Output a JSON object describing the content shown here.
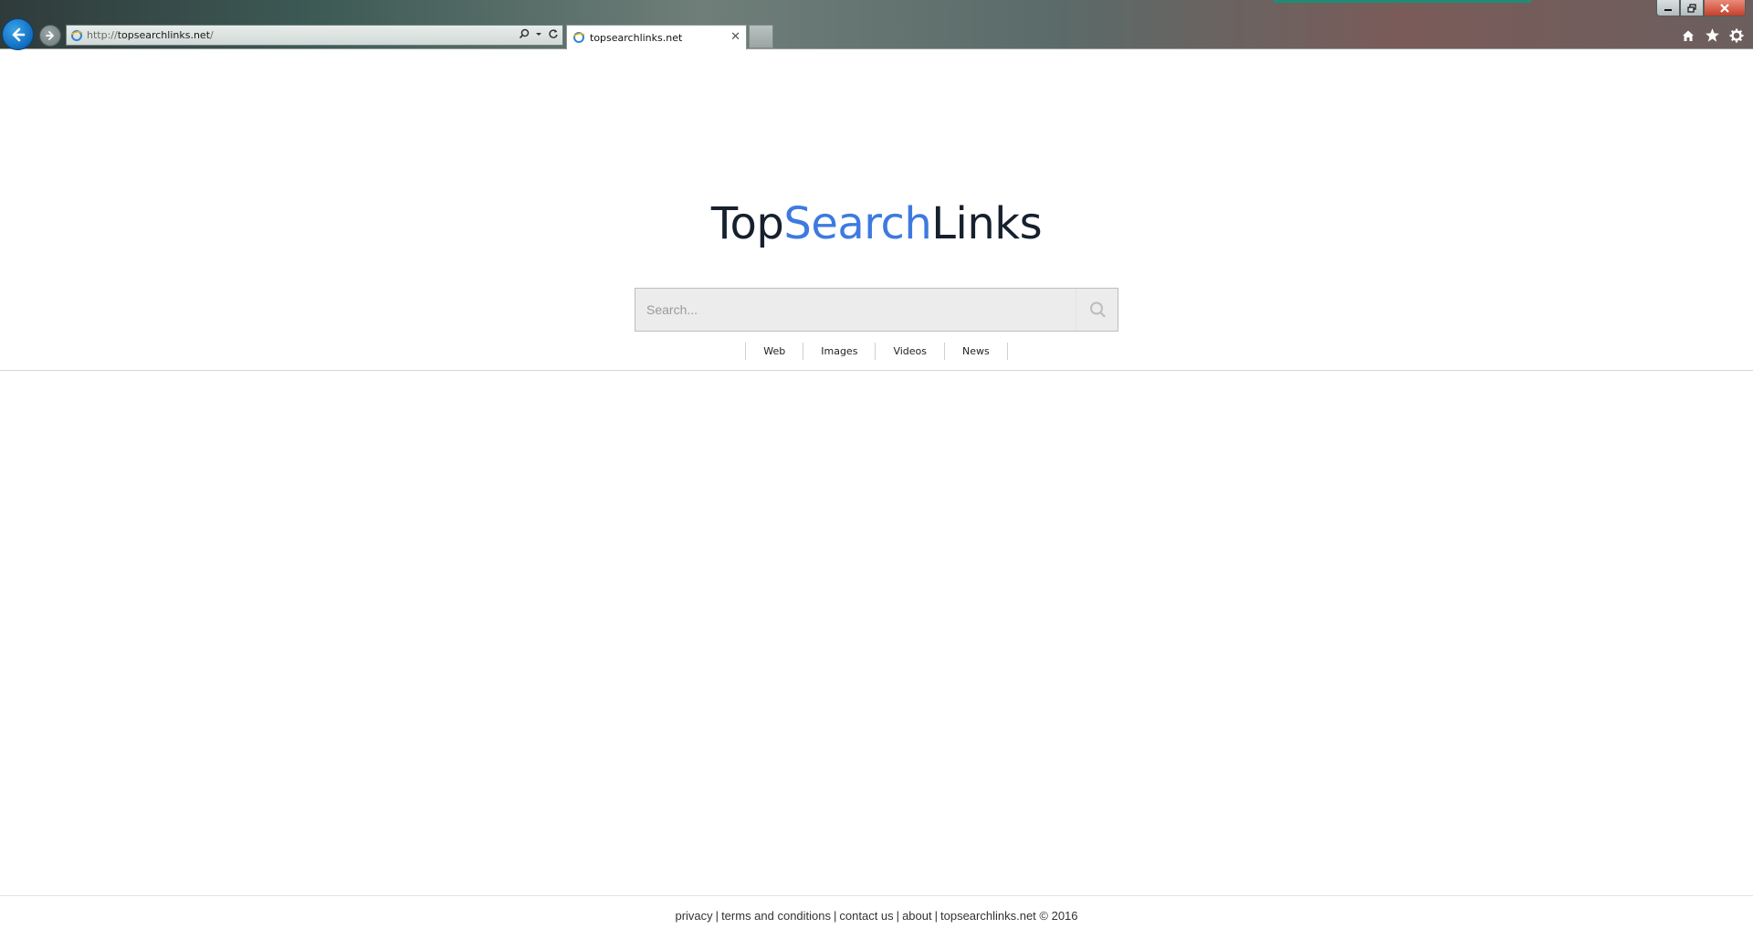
{
  "browser": {
    "url_protocol": "http://",
    "url_host": "topsearchlinks.net",
    "url_trail": "/",
    "tab_title": "topsearchlinks.net",
    "tab_close": "✕"
  },
  "logo": {
    "part1": "Top",
    "part2": "Search",
    "part3": "Links"
  },
  "search": {
    "placeholder": "Search..."
  },
  "search_tabs": [
    "Web",
    "Images",
    "Videos",
    "News"
  ],
  "footer": {
    "privacy": "privacy",
    "terms": "terms and conditions",
    "contact": "contact us",
    "about": "about",
    "copyright": "topsearchlinks.net © 2016",
    "separator": "|"
  },
  "colors": {
    "logo_dark": "#16202e",
    "logo_accent": "#3d7ae0"
  }
}
